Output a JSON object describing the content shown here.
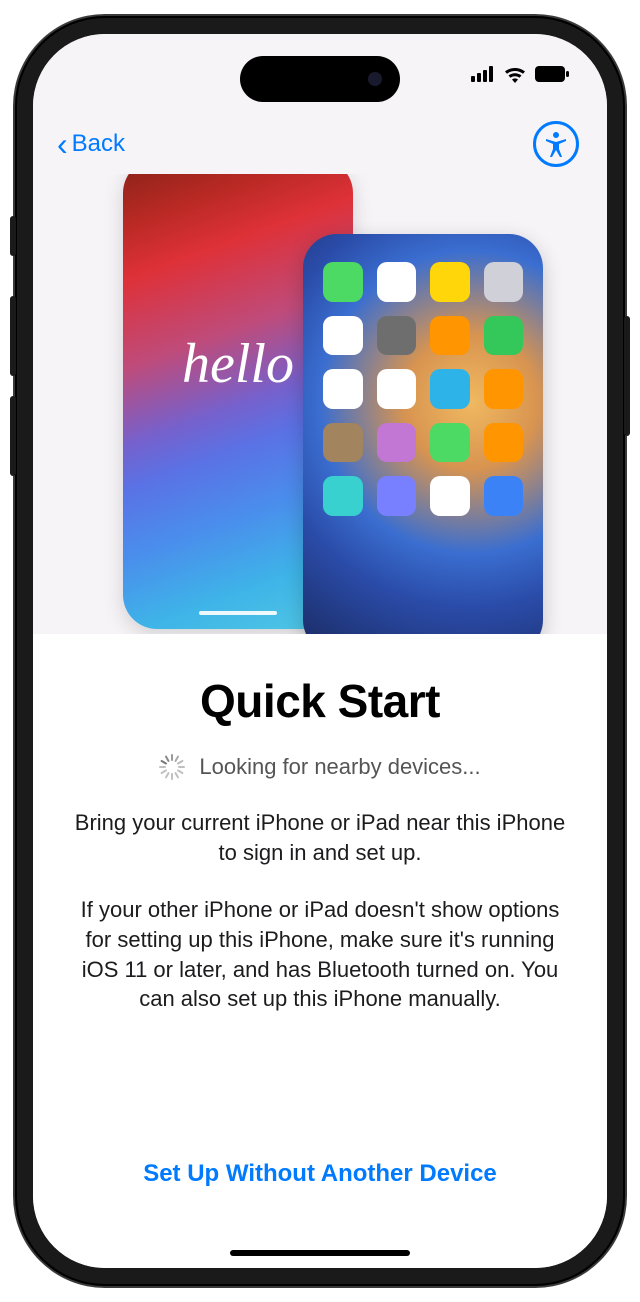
{
  "nav": {
    "back_label": "Back"
  },
  "hero": {
    "hello_text": "hello",
    "app_colors": [
      "#4cd964",
      "#ffffff",
      "#ffd60a",
      "#d0d0d8",
      "#ffffff",
      "#6e6e6e",
      "#ff9500",
      "#34c759",
      "#ffffff",
      "#ffffff",
      "#2eb3e8",
      "#ff9500",
      "#a2845e",
      "#c277d4",
      "#4cd964",
      "#ff9500",
      "#38d1cf",
      "#7980ff",
      "#ffffff",
      "#3b82f6"
    ]
  },
  "main": {
    "title": "Quick Start",
    "searching_text": "Looking for nearby devices...",
    "body1": "Bring your current iPhone or iPad near this iPhone to sign in and set up.",
    "body2": "If your other iPhone or iPad doesn't show options for setting up this iPhone, make sure it's running iOS 11 or later, and has Bluetooth turned on. You can also set up this iPhone manually."
  },
  "footer": {
    "link_label": "Set Up Without Another Device"
  }
}
